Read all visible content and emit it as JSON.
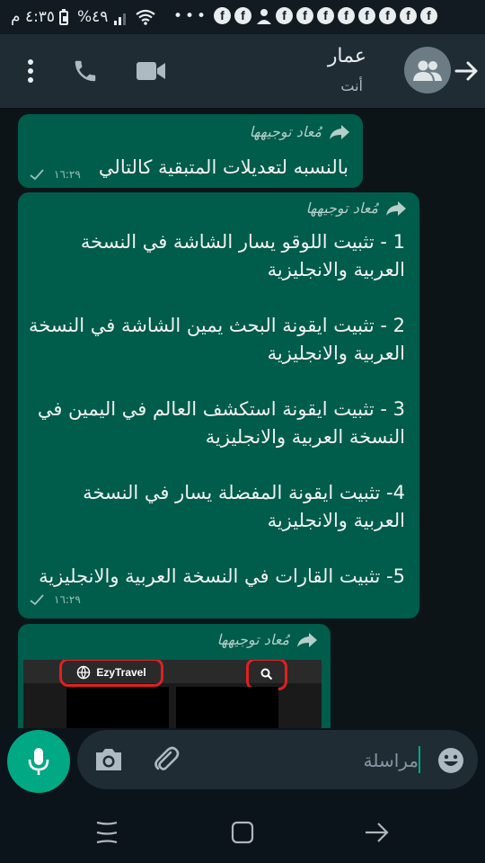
{
  "status_bar": {
    "time": "٤:٣٥ م",
    "battery_percent": "%٤٩",
    "battery_level": 0.49,
    "overflow": "•••",
    "notification_icons": [
      "f",
      "f",
      "person",
      "f",
      "f",
      "f",
      "f",
      "f",
      "f",
      "f",
      "f"
    ]
  },
  "header": {
    "contact_name": "عمار",
    "contact_subtitle": "أنت",
    "icons": [
      "back-arrow-icon",
      "group-avatar-icon",
      "video-call-icon",
      "voice-call-icon",
      "more-vert-icon"
    ]
  },
  "messages": [
    {
      "forwarded_label": "مُعاد توجيهها",
      "text": "بالنسبه لتعديلات المتبقية كالتالي",
      "time": "١٦:٢٩"
    },
    {
      "forwarded_label": "مُعاد توجيهها",
      "text": "1 - تثبيت اللوقو يسار الشاشة في النسخة العربية والانجليزية\n\n2 - تثبيت ايقونة البحث يمين الشاشة في النسخة العربية والانجليزية\n\n3 - تثبيت ايقونة استكشف العالم في اليمين في النسخة العربية والانجليزية\n\n4- تثبيت ايقونة المفضلة يسار في النسخة العربية والانجليزية\n\n5- تثبيت القارات في النسخة العربية والانجليزية",
      "time": "١٦:٢٩"
    },
    {
      "forwarded_label": "مُعاد توجيهها",
      "image_logo_text": "EzyTravel"
    }
  ],
  "input": {
    "placeholder": "مراسلة"
  },
  "colors": {
    "accent": "#00a884",
    "bubble_out": "#005c4b",
    "header_bg": "#1f2c34",
    "chat_bg": "#0d1418",
    "highlight_red": "#e02020"
  }
}
